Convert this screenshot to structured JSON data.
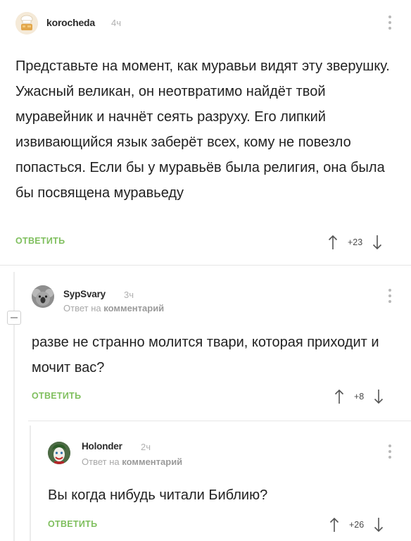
{
  "comments": [
    {
      "author": "korocheda",
      "time": "4ч",
      "text": "Представьте на момент, как муравьи видят эту зверушку. Ужасный великан, он неотвратимо найдёт твой муравейник и начнёт сеять разруху. Его липкий извивающийся язык заберёт всех, кому не повезло попасться. Если бы у муравьёв была религия, она была бы посвящена муравьеду",
      "reply_label": "ОТВЕТИТЬ",
      "score": "+23"
    },
    {
      "author": "SypSvary",
      "time": "3ч",
      "reply_to_prefix": "Ответ на",
      "reply_to_target": "комментарий",
      "text": "разве не странно молится твари, которая приходит и мочит вас?",
      "reply_label": "ОТВЕТИТЬ",
      "score": "+8"
    },
    {
      "author": "Holonder",
      "time": "2ч",
      "reply_to_prefix": "Ответ на",
      "reply_to_target": "комментарий",
      "text": "Вы когда нибудь читали Библию?",
      "reply_label": "ОТВЕТИТЬ",
      "score": "+26"
    }
  ],
  "icons": {
    "upvote": "arrow-up-icon",
    "downvote": "arrow-down-icon",
    "menu": "more-vertical-icon",
    "collapse": "collapse-minus-icon"
  },
  "colors": {
    "accent_green": "#7fbf5e",
    "muted": "#a8a8a8"
  }
}
